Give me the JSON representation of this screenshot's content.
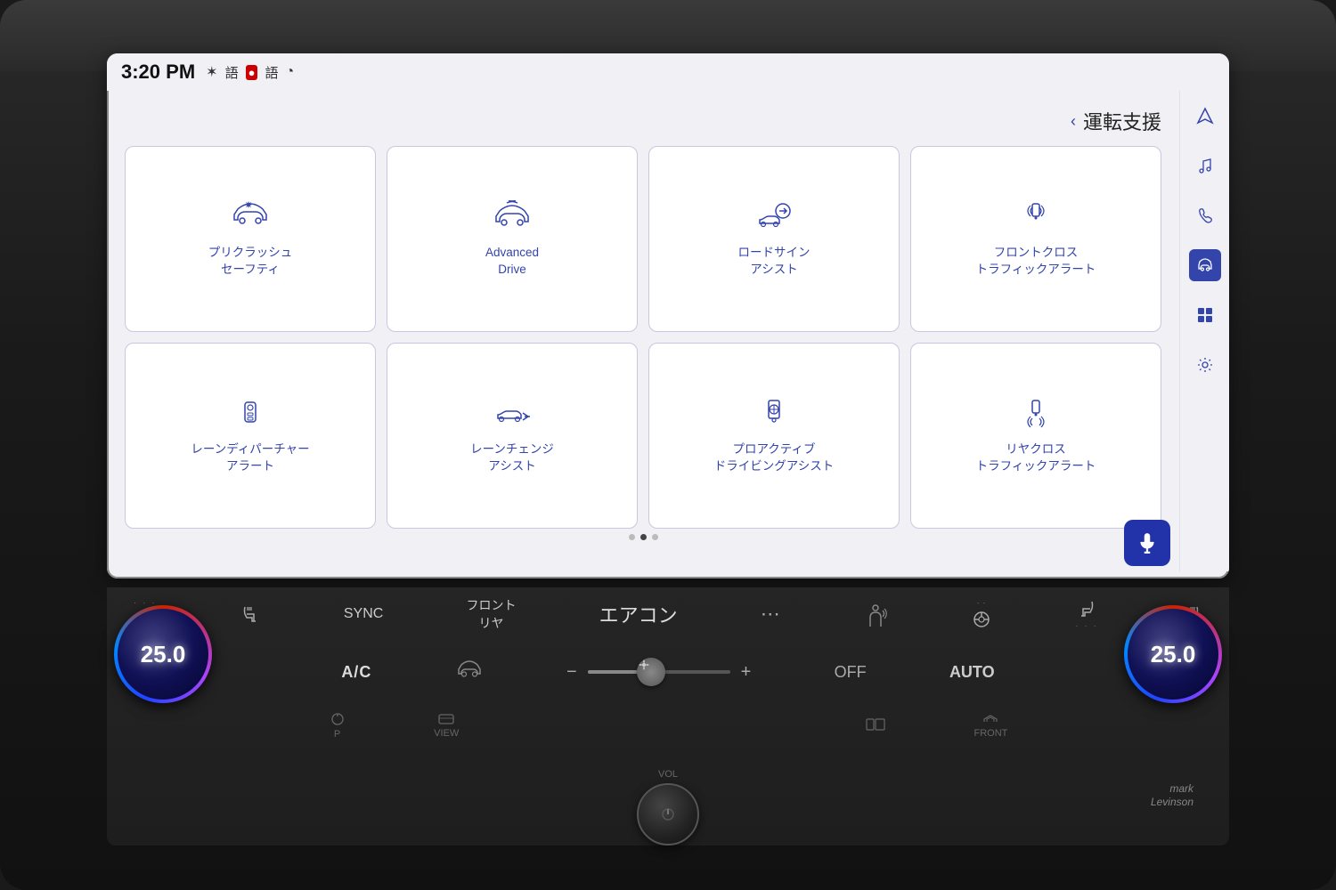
{
  "status": {
    "time": "3:20 PM",
    "icons": [
      "bluetooth",
      "text",
      "camera",
      "text2",
      "wireless"
    ]
  },
  "header": {
    "back_arrow": "‹",
    "title": "運転支援"
  },
  "menu_items": [
    {
      "id": "pre-crash",
      "label": "プリクラッシュ\nセーフティ",
      "icon": "car-crash"
    },
    {
      "id": "advanced-drive",
      "label": "Advanced\nDrive",
      "icon": "advanced-car"
    },
    {
      "id": "road-sign",
      "label": "ロードサイン\nアシスト",
      "icon": "road-sign"
    },
    {
      "id": "front-cross",
      "label": "フロントクロス\nトラフィックアラート",
      "icon": "front-cross"
    },
    {
      "id": "lane-departure",
      "label": "レーンディパーチャー\nアラート",
      "icon": "lane-departure"
    },
    {
      "id": "lane-change",
      "label": "レーンチェンジ\nアシスト",
      "icon": "lane-change"
    },
    {
      "id": "proactive",
      "label": "プロアクティブ\nドライビングアシスト",
      "icon": "proactive"
    },
    {
      "id": "rear-cross",
      "label": "リヤクロス\nトラフィックアラート",
      "icon": "rear-cross"
    }
  ],
  "sidebar": {
    "icons": [
      "navigation",
      "music",
      "phone",
      "car",
      "grid",
      "settings"
    ]
  },
  "voice_button": "mic",
  "controls": {
    "seat_heat_left": "seat-heat-left",
    "seat_ventilate_left": "seat-ventilate",
    "sync": "SYNC",
    "front_rear": "フロント\nリヤ",
    "aircon": "エアコン",
    "grid": "grid",
    "person_temp": "person-temp",
    "steering_heat": "steering-heat",
    "seat_heat_right": "seat-heat-right",
    "seat_vent_right": "seat-vent-right",
    "ac": "A/C",
    "car_icon": "car-icon",
    "fan_minus": "−",
    "fan_plus": "+",
    "fan_speed_value": "4",
    "off": "OFF",
    "auto": "AUTO",
    "temp_left": "25.0",
    "temp_right": "25.0",
    "park": "P",
    "view": "VIEW",
    "vol": "VOL",
    "screen_mode": "screen",
    "front": "FRONT",
    "mark_levinson_line1": "mark",
    "mark_levinson_line2": "Levinson"
  }
}
